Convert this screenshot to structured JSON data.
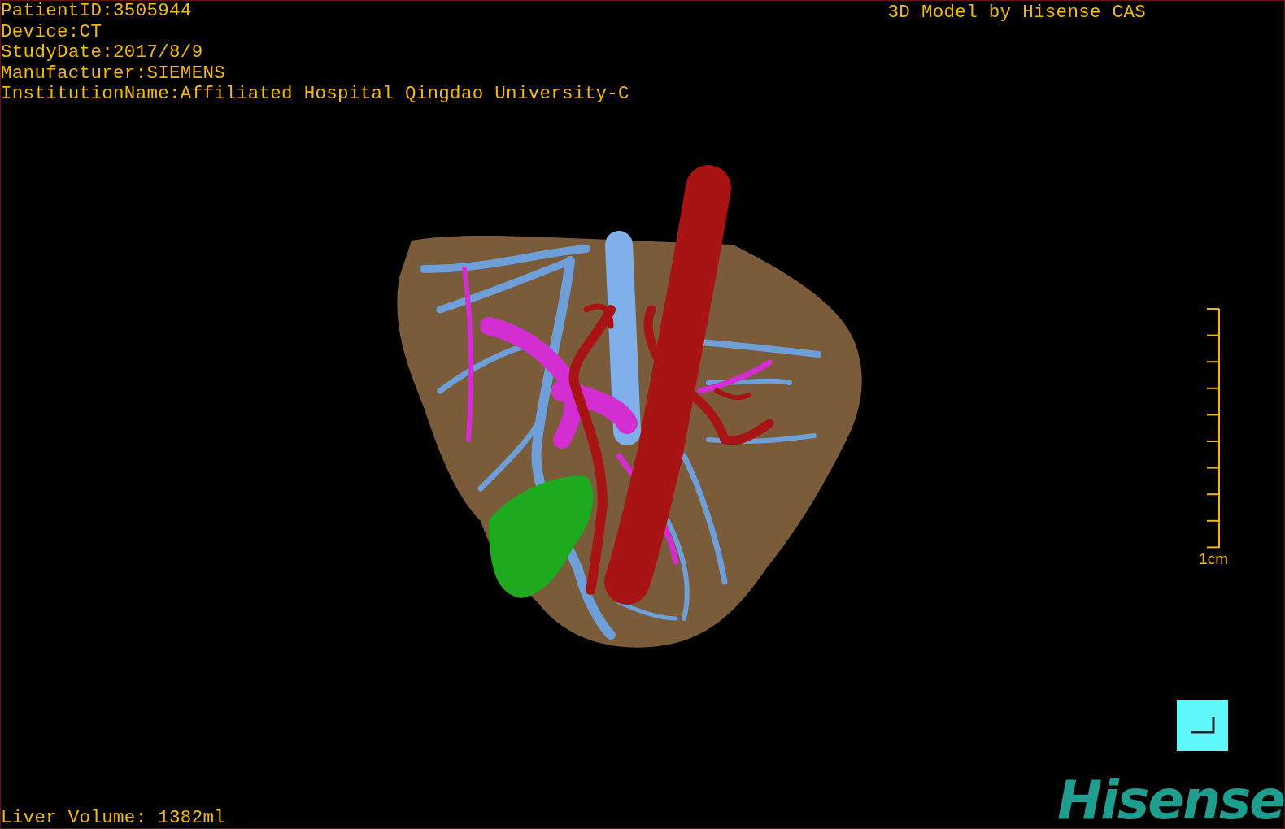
{
  "study_info": [
    "PatientID:3505944",
    "Device:CT",
    "StudyDate:2017/8/9",
    "Manufacturer:SIEMENS",
    "InstitutionName:Affiliated Hospital Qingdao University-C"
  ],
  "viewer_title": "3D Model by Hisense CAS",
  "scale_bar": {
    "label": "1cm"
  },
  "liver_volume": "Liver Volume: 1382ml",
  "logo": "Hisense"
}
